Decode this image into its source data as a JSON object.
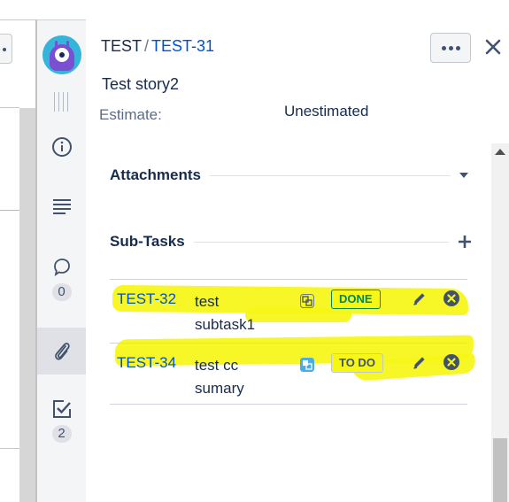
{
  "issue": {
    "project": "TEST",
    "separator": "/",
    "key": "TEST-31",
    "summary": "Test story2",
    "estimate_label": "Estimate:",
    "estimate_value": "Unestimated"
  },
  "rail": {
    "comments_count": "0",
    "subtasks_count": "2"
  },
  "sections": {
    "attachments_title": "Attachments",
    "subtasks_title": "Sub-Tasks"
  },
  "subtasks": [
    {
      "key": "TEST-32",
      "summary_line1": "test",
      "summary_line2": "subtask1",
      "status": "DONE",
      "status_color": "#00875a",
      "status_bg": "#e3fcef"
    },
    {
      "key": "TEST-34",
      "summary_line1": "test cc",
      "summary_line2": "sumary",
      "status": "TO DO",
      "status_color": "#42526e",
      "status_bg": "#f4f5f7"
    }
  ],
  "colors": {
    "link": "#0052cc",
    "highlight": "#f6f617",
    "done": "#00875a"
  },
  "icons": [
    "ellipsis-icon",
    "close-icon",
    "info-icon",
    "description-icon",
    "comment-icon",
    "attachment-icon",
    "checkbox-icon",
    "subtask-type-icon",
    "edit-icon",
    "remove-icon",
    "plus-icon",
    "chevron-down-icon"
  ]
}
